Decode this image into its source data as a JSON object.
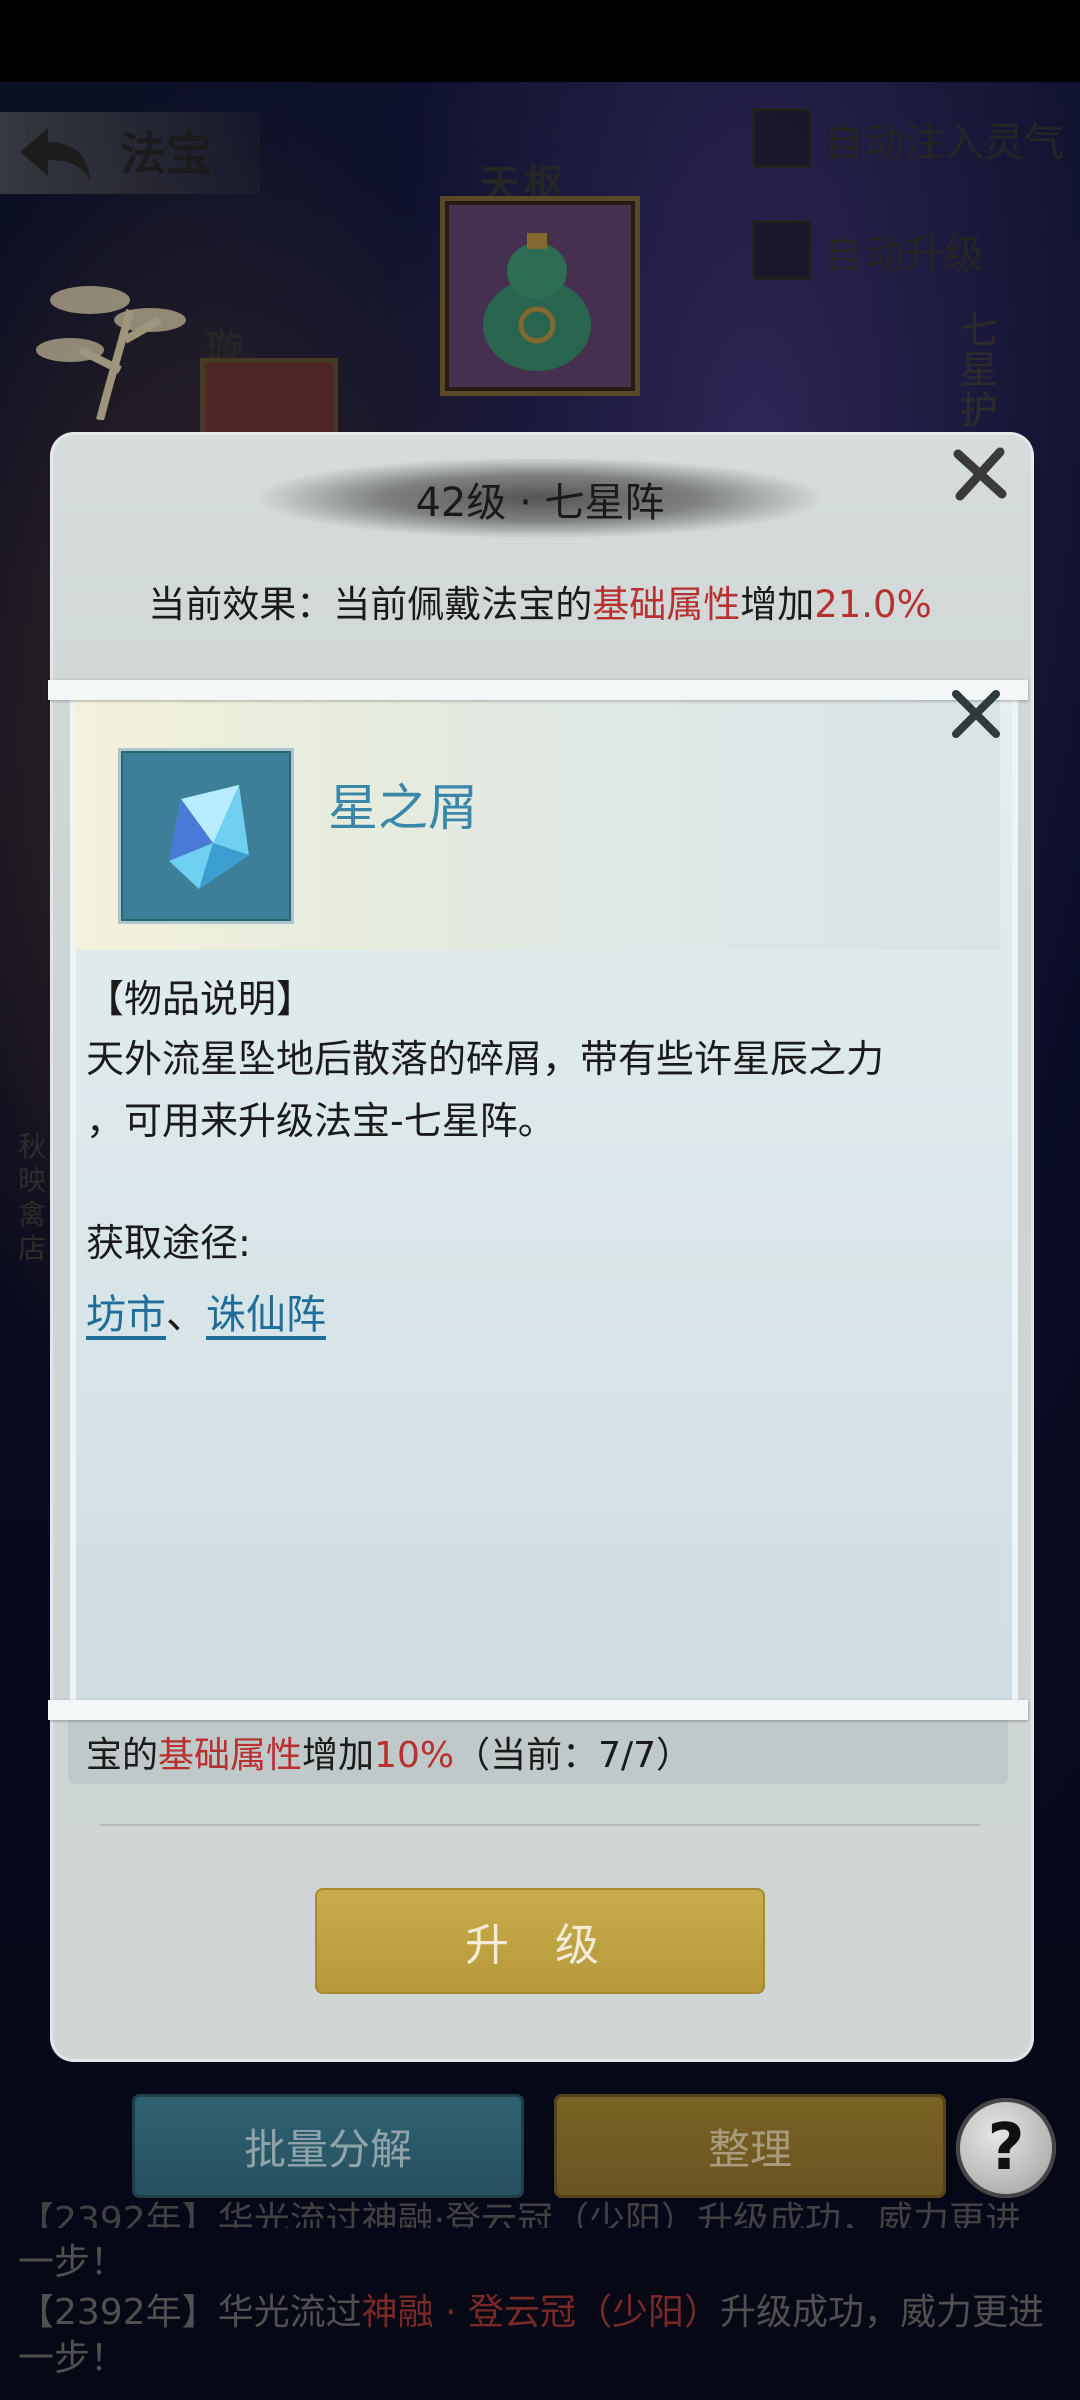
{
  "header": {
    "title": "法宝"
  },
  "options": {
    "auto_inject": "自动注入灵气",
    "auto_upgrade": "自动升级"
  },
  "scene": {
    "slot_top": "天枢",
    "slot_left": "璇",
    "vertical_text": "七星护",
    "left_side_text": "秋映禽店"
  },
  "modal": {
    "title": "42级 · 七星阵",
    "effect_prefix": "当前效果：当前佩戴法宝的",
    "effect_highlight": "基础属性",
    "effect_mid": "增加",
    "effect_value": "21.0%",
    "bonus_prefix": "宝的",
    "bonus_highlight": "基础属性",
    "bonus_mid": "增加",
    "bonus_value": "10%",
    "bonus_suffix": "（当前：7/7）",
    "upgrade_label": "升 级"
  },
  "item": {
    "name": "星之屑",
    "desc_heading": "【物品说明】",
    "desc_line1": "天外流星坠地后散落的碎屑，带有些许星辰之力",
    "desc_line2": "，可用来升级法宝-七星阵。",
    "source_heading": "获取途径:",
    "source_1": "坊市",
    "source_sep": "、",
    "source_2": "诛仙阵"
  },
  "buttons": {
    "batch": "批量分解",
    "arrange": "整理",
    "help": "?"
  },
  "log": {
    "partial_line": "【2392年】华光流过神融·登云冠（少阳）升级成功，威力更进",
    "partial_line_end": "一步！",
    "entry_year": "【2392年】",
    "entry_text1": "华光流过",
    "entry_item": "神融 · 登云冠（少阳）",
    "entry_text2": "升级成功，威力更进",
    "entry_end": "一步！"
  },
  "colors": {
    "highlight_red": "#b83030",
    "item_blue": "#3a87a9",
    "link_blue": "#1f6d98",
    "upgrade_gold": "#c9ad4c"
  }
}
